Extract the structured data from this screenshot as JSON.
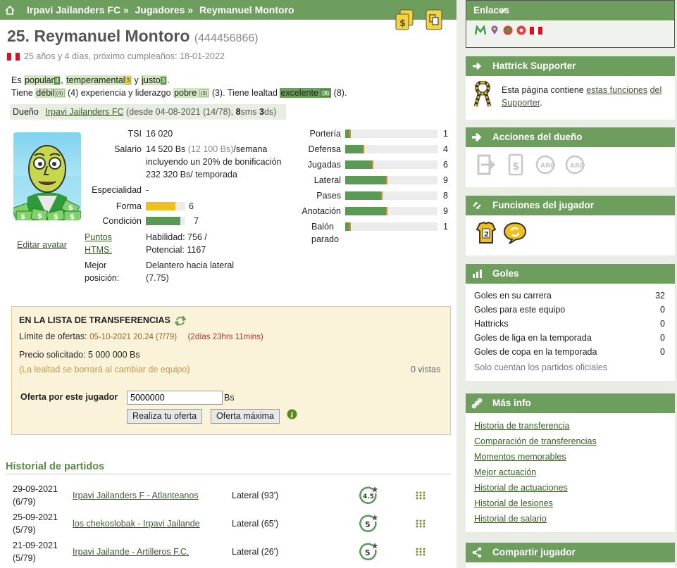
{
  "breadcrumb": {
    "team": "Irpavi Jailanders FC »",
    "section": "Jugadores »",
    "player": "Reymanuel Montoro"
  },
  "player": {
    "title": "25. Reymanuel Montoro",
    "id": "(444456866)",
    "age_text": "25 años y 4 días, próximo cumpleaños: 18-01-2022",
    "desc": {
      "es": "Es",
      "popular": "popular",
      "comma1": ",",
      "temperamental": "temperamental",
      "y": "y",
      "justo": "justo",
      "dot": ".",
      "tiene": "Tiene",
      "debil": "débil",
      "exp_text": "(4) experiencia y liderazgo",
      "pobre": "pobre",
      "tiene_lealtad": "(3). Tiene lealtad",
      "excelente": "excelente",
      "end": "(8).",
      "lvl_pop": "4",
      "lvl_temp": "3",
      "lvl_justo": "3",
      "lvl_debil": "(4)",
      "lvl_pobre": "(3)",
      "lvl_exc": "(8)"
    },
    "owner_label": "Dueño",
    "owner_team": "Irpavi Jailanders FC",
    "owner_since": "(desde 04-08-2021 (14/78),",
    "owner_weeks": "8",
    "owner_sms": "sms",
    "owner_days": "3",
    "owner_ds": "ds)",
    "edit_avatar": "Editar avatar"
  },
  "stats": {
    "tsi_label": "TSI",
    "tsi_value": "16 020",
    "salary_label": "Salario",
    "salary_line1": "14 520 Bs",
    "salary_paren": "(12 100 Bs)",
    "salary_week": "/semana",
    "salary_line2": "incluyendo un 20% de bonificación",
    "salary_line3": "232 320 Bs/ temporada",
    "spec_label": "Especialidad",
    "spec_value": "-",
    "forma_label": "Forma",
    "forma_value": "6",
    "cond_label": "Condición",
    "cond_value": "7",
    "htms_label1": "Puntos",
    "htms_label2": "HTMS:",
    "htms_line1": "Habilidad: 756 /",
    "htms_line2": "Potencial: 1167",
    "best_label1": "Mejor",
    "best_label2": "posición:",
    "best_line1": "Delantero hacia lateral",
    "best_line2": "(7.75)"
  },
  "skills": [
    {
      "label": "Portería",
      "value": "1",
      "level": 1
    },
    {
      "label": "Defensa",
      "value": "4",
      "level": 4
    },
    {
      "label": "Jugadas",
      "value": "6",
      "level": 6
    },
    {
      "label": "Lateral",
      "value": "9",
      "level": 9
    },
    {
      "label": "Pases",
      "value": "8",
      "level": 8
    },
    {
      "label": "Anotación",
      "value": "9",
      "level": 9
    },
    {
      "label": "Balón parado",
      "label1": "Balón",
      "label2": "parado",
      "value": "1",
      "level": 1
    }
  ],
  "transfer": {
    "heading": "EN LA LISTA DE TRANSFERENCIAS",
    "deadline_label": "Límite de ofertas:",
    "deadline_value": "05-10-2021 20.24 (7/79)",
    "remaining": "(2días 23hrs 11mins)",
    "price_label": "Precio solicitado: 5 000 000 Bs",
    "loyalty_note": "(La lealtad se borrará al cambiar de equipo)",
    "views": "0 vistas",
    "offer_label": "Oferta por este jugador",
    "offer_value": "5000000",
    "currency": "Bs",
    "btn_offer": "Realiza tu oferta",
    "btn_max": "Oferta máxima"
  },
  "matches": {
    "title": "Historial de partidos",
    "rows": [
      {
        "date": "29-09-2021",
        "week": "(6/79)",
        "match": "Irpavi Jailanders F - Atlanteanos",
        "pos": "Lateral (93')",
        "stars": "4.5"
      },
      {
        "date": "25-09-2021",
        "week": "(5/79)",
        "match": "los chekoslobak - Irpavi Jailande",
        "pos": "Lateral (65')",
        "stars": "5"
      },
      {
        "date": "21-09-2021",
        "week": "(5/79)",
        "match": "Irpavi Jailande - Artilleros F.C.",
        "pos": "Lateral (26')",
        "stars": "5"
      }
    ]
  },
  "sidebar": {
    "links_title": "Enlaces",
    "supporter_title": "Hattrick Supporter",
    "supporter_text1": "Esta página contiene",
    "supporter_link1": "estas funciones",
    "supporter_link2": "del Supporter",
    "supporter_end": ".",
    "owner_actions_title": "Acciones del dueño",
    "player_funcs_title": "Funciones del jugador",
    "goals_title": "Goles",
    "goals": [
      {
        "label": "Goles en su carrera",
        "value": "32"
      },
      {
        "label": "Goles para este equipo",
        "value": "0"
      },
      {
        "label": "Hattricks",
        "value": "0"
      },
      {
        "label": "Goles de liga en la temporada",
        "value": "0"
      },
      {
        "label": "Goles de copa en la temporada",
        "value": "0"
      }
    ],
    "goals_note": "Solo cuentan los partidos oficiales",
    "more_title": "Más info",
    "more_links": [
      "Historia de transferencia",
      "Comparación de transferencias",
      "Momentos memorables",
      "Mejor actuación",
      "Historial de actuaciones",
      "Historial de lesiones",
      "Historial de salario"
    ],
    "share_title": "Compartir jugador"
  },
  "colors": {
    "header_green": "#6e9e5e",
    "skill_green": "#5a9a55",
    "form_yellow": "#f0c020",
    "transfer_bg": "#fbf3d9"
  }
}
